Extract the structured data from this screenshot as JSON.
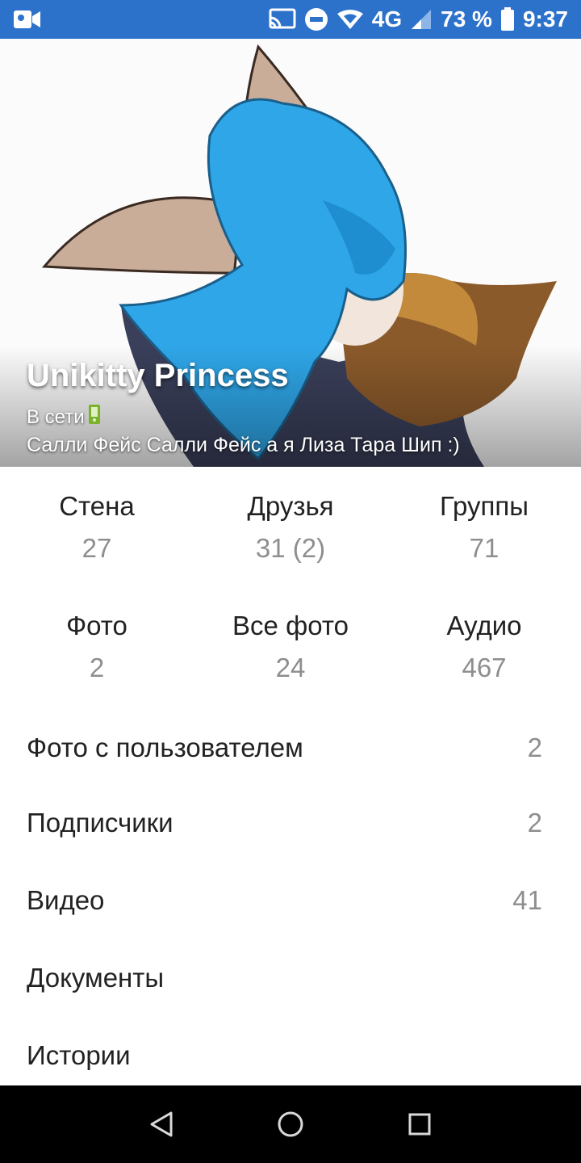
{
  "status_bar": {
    "battery": "73 %",
    "time": "9:37",
    "network": "4G",
    "icons": [
      "video-camera-icon",
      "cast-icon",
      "do-not-disturb-icon",
      "wifi-icon",
      "signal-icon",
      "battery-icon"
    ],
    "background_color": "#2c72cb"
  },
  "profile": {
    "name": "Unikitty Princess",
    "online_text": "В сети",
    "online_icon": "mobile-phone-icon",
    "status_text": "Салли Фейс Салли Фейс а я Лиза Тара Шип :)"
  },
  "counters": [
    {
      "label": "Стена",
      "value": "27"
    },
    {
      "label": "Друзья",
      "value": "31 (2)"
    },
    {
      "label": "Группы",
      "value": "71"
    },
    {
      "label": "Фото",
      "value": "2"
    },
    {
      "label": "Все фото",
      "value": "24"
    },
    {
      "label": "Аудио",
      "value": "467"
    }
  ],
  "menu": [
    {
      "label": "Фото с пользователем",
      "count": "2"
    },
    {
      "label": "Подписчики",
      "count": "2"
    },
    {
      "label": "Видео",
      "count": "41"
    },
    {
      "label": "Документы",
      "count": ""
    },
    {
      "label": "Истории",
      "count": ""
    }
  ],
  "nav_bar": {
    "icons": [
      "back-icon",
      "home-icon",
      "recents-icon"
    ]
  }
}
